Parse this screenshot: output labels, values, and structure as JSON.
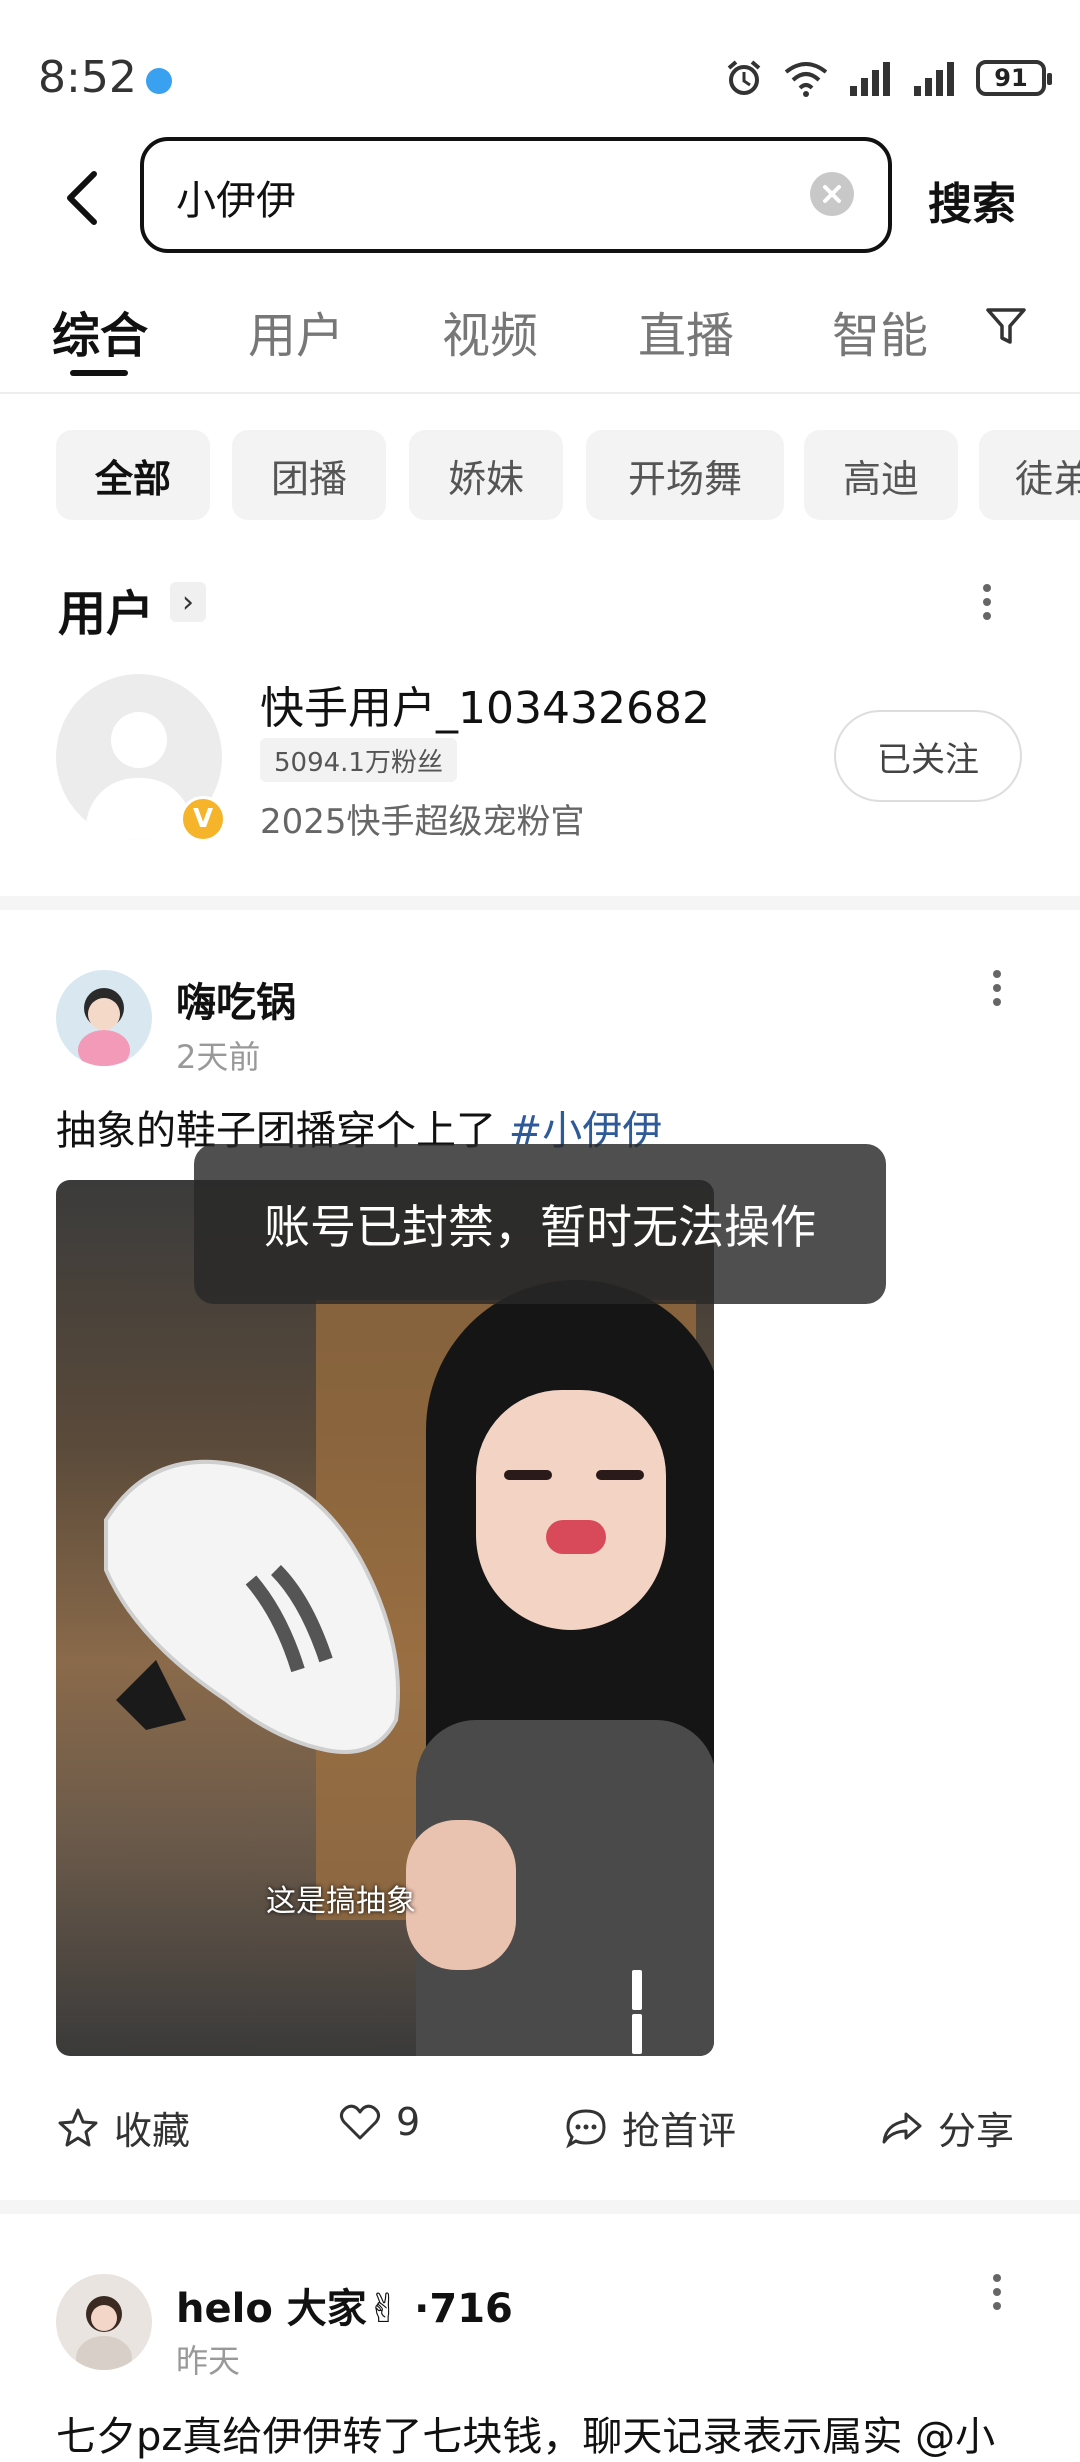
{
  "status_bar": {
    "time": "8:52",
    "battery": "91"
  },
  "search": {
    "query": "小伊伊",
    "button": "搜索"
  },
  "tabs": [
    {
      "label": "综合",
      "active": true
    },
    {
      "label": "用户"
    },
    {
      "label": "视频"
    },
    {
      "label": "直播"
    },
    {
      "label": "智能"
    }
  ],
  "chips": [
    {
      "label": "全部",
      "active": true
    },
    {
      "label": "团播"
    },
    {
      "label": "娇妹"
    },
    {
      "label": "开场舞"
    },
    {
      "label": "高迪"
    },
    {
      "label": "徒弟"
    }
  ],
  "user_section": {
    "title": "用户",
    "user": {
      "name": "快手用户_103432682",
      "fans": "5094.1万粉丝",
      "desc": "2025快手超级宠粉官",
      "badge": "V",
      "follow_label": "已关注"
    }
  },
  "post1": {
    "author": "嗨吃锅",
    "time": "2天前",
    "text": "抽象的鞋子团播穿个上了 ",
    "hashtag": "#小伊伊",
    "video_subtitle": "这是搞抽象",
    "toast": "账号已封禁，暂时无法操作",
    "actions": {
      "collect": "收藏",
      "like_count": "9",
      "comment": "抢首评",
      "share": "分享"
    }
  },
  "post2": {
    "author": "helo 大家✌ ·716",
    "time": "昨天",
    "text": "七夕pz真给伊伊转了七块钱，聊天记录表示属实 @小"
  },
  "colors": {
    "hashtag": "#2e5a9a",
    "badge": "#f5b429",
    "toast_bg": "#282828"
  }
}
